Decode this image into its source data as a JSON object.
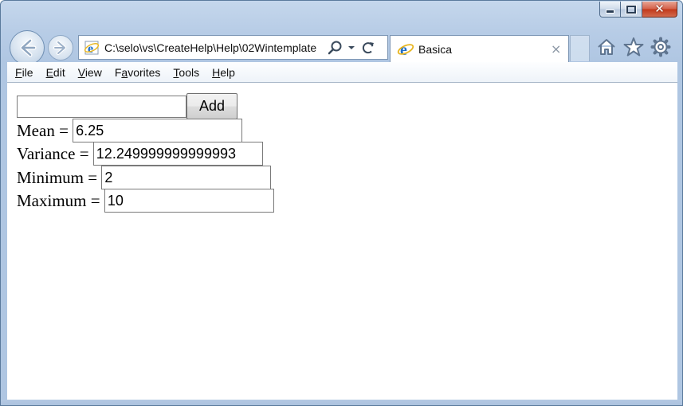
{
  "browser": {
    "address": "C:\\selo\\vs\\CreateHelp\\Help\\02Wintemplate",
    "tab_title": "Basica",
    "tab_close": "×",
    "close_glyph": "✕"
  },
  "menu": [
    {
      "acc": "F",
      "rest": "ile"
    },
    {
      "acc": "E",
      "rest": "dit"
    },
    {
      "acc": "V",
      "rest": "iew"
    },
    {
      "pre": "F",
      "acc": "a",
      "rest": "vorites"
    },
    {
      "acc": "T",
      "rest": "ools"
    },
    {
      "acc": "H",
      "rest": "elp"
    }
  ],
  "form": {
    "input_value": "",
    "add_label": "Add"
  },
  "stats": {
    "mean_label": "Mean = ",
    "mean_value": "6.25",
    "variance_label": "Variance = ",
    "variance_value": "12.249999999999993",
    "minimum_label": "Minimum = ",
    "minimum_value": "2",
    "maximum_label": "Maximum = ",
    "maximum_value": "10"
  },
  "colors": {
    "frame": "#b7cce6",
    "close_button": "#c2391b",
    "ie_blue": "#1f6fc9",
    "ie_ring": "#e8b623"
  },
  "icons": [
    "back-arrow-icon",
    "forward-arrow-icon",
    "ie-logo-icon",
    "search-icon",
    "dropdown-arrow-icon",
    "refresh-icon",
    "home-icon",
    "favorites-star-icon",
    "gear-icon"
  ]
}
